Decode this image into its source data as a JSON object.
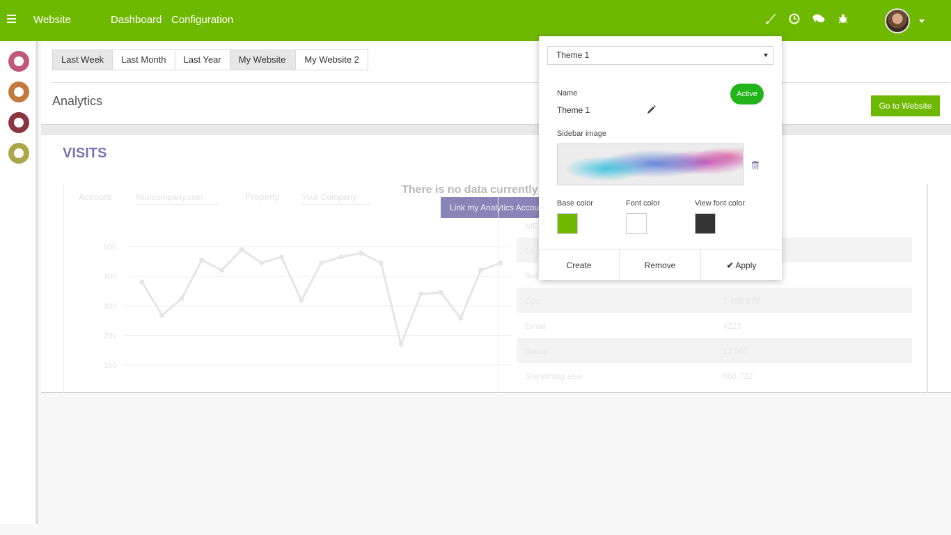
{
  "topbar": {
    "brand": "Website",
    "nav": [
      "Dashboard",
      "Configuration"
    ],
    "icons": [
      "brush-icon",
      "clock-icon",
      "chat-icon",
      "bug-icon"
    ],
    "accent_color": "#6fb800"
  },
  "rail": {
    "icons": [
      {
        "name": "messages-icon",
        "color": "#c1577c"
      },
      {
        "name": "globe-icon",
        "color": "#c47a3c"
      },
      {
        "name": "cubes-icon",
        "color": "#8a3540"
      },
      {
        "name": "settings-icon",
        "color": "#a9a74a"
      }
    ]
  },
  "tabs": [
    "Last Week",
    "Last Month",
    "Last Year",
    "My Website",
    "My Website 2"
  ],
  "page_title": "Analytics",
  "goto_button": "Go to Website",
  "visits_title": "VISITS",
  "filters": {
    "account_label": "Account",
    "account_value": "Yourcompany.com",
    "property_label": "Property",
    "property_value": "Your Company"
  },
  "chart_data": {
    "type": "line",
    "y_ticks": [
      "500",
      "400",
      "300",
      "200",
      "100"
    ],
    "ylim": [
      100,
      500
    ],
    "x": [
      0,
      1,
      2,
      3,
      4,
      5,
      6,
      7,
      8,
      9,
      10,
      11,
      12,
      13,
      14,
      15,
      16,
      17,
      18,
      19,
      20,
      21,
      22,
      23
    ],
    "values": [
      380,
      268,
      325,
      455,
      420,
      490,
      445,
      465,
      318,
      445,
      465,
      478,
      445,
      170,
      340,
      345,
      258,
      420,
      445,
      0,
      0,
      0,
      0,
      0
    ]
  },
  "no_data_text": "There is no data currently",
  "link_button": "Link my Analytics Account",
  "table": {
    "header": "ME",
    "rows": [
      {
        "c1": "Or",
        "c2": ""
      },
      {
        "c1": "Ref",
        "c2": ""
      },
      {
        "c1": "Cpc",
        "c2": "1 485 678"
      },
      {
        "c1": "Email",
        "c2": "4223"
      },
      {
        "c1": "Social",
        "c2": "13 567"
      },
      {
        "c1": "Something else",
        "c2": "666 732"
      }
    ]
  },
  "theme_popover": {
    "selected_theme": "Theme 1",
    "name_label": "Name",
    "name_value": "Theme 1",
    "active_label": "Active",
    "sidebar_image_label": "Sidebar image",
    "base_color_label": "Base color",
    "base_color": "#6fb800",
    "font_color_label": "Font color",
    "font_color": "#ffffff",
    "view_font_color_label": "View font color",
    "view_font_color": "#333333",
    "create_label": "Create",
    "remove_label": "Remove",
    "apply_label": "Apply"
  }
}
